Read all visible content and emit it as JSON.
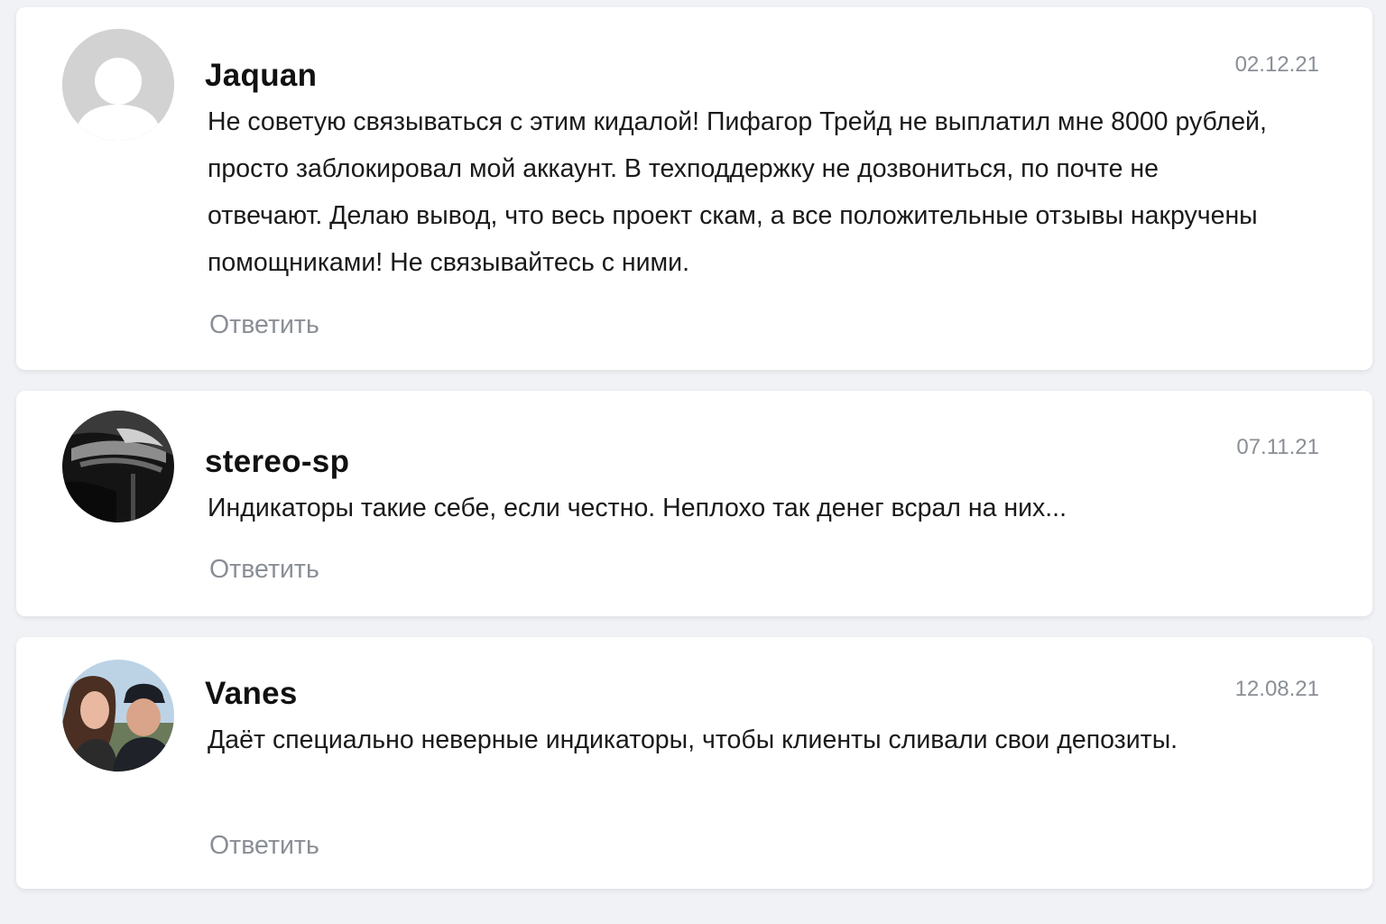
{
  "comments": [
    {
      "author": "Jaquan",
      "date": "02.12.21",
      "text": "Не советую связываться с этим кидалой! Пифагор Трейд не выплатил мне 8000 рублей, просто заблокировал мой аккаунт. В техподдержку не дозвониться, по почте не отвечают. Делаю вывод, что весь проект скам, а все положительные отзывы накручены помощниками! Не связывайтесь с ними.",
      "reply_label": "Ответить",
      "avatar_icon": "default-user-icon"
    },
    {
      "author": "stereo-sp",
      "date": "07.11.21",
      "text": "Индикаторы такие себе, если честно. Неплохо так денег всрал на них...",
      "reply_label": "Ответить",
      "avatar_icon": "user-photo-dark"
    },
    {
      "author": "Vanes",
      "date": "12.08.21",
      "text": "Даёт специально неверные индикаторы, чтобы клиенты сливали свои депозиты.",
      "reply_label": "Ответить",
      "avatar_icon": "user-photo-couple"
    }
  ],
  "colors": {
    "background": "#f0f2f5",
    "card": "#ffffff",
    "author": "#111111",
    "text": "#1a1a1a",
    "muted": "#8a8f96"
  }
}
